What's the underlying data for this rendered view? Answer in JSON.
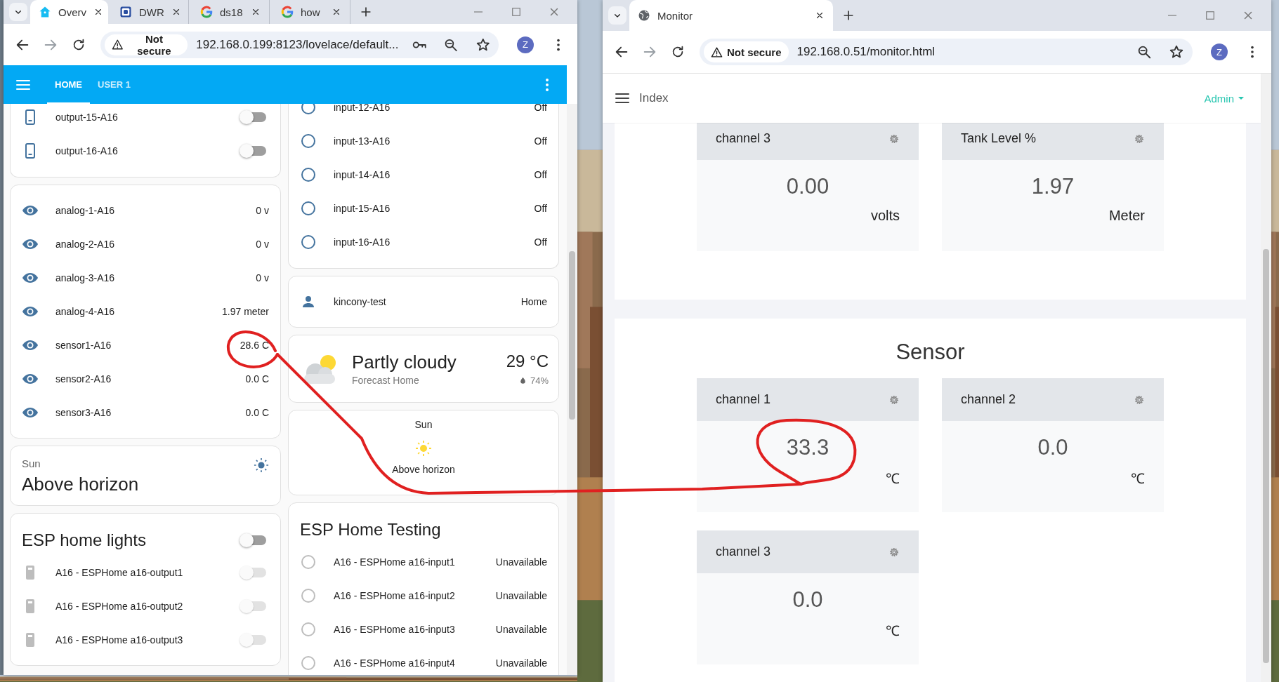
{
  "windows": [
    {
      "kind": "home-assistant",
      "tabs": [
        {
          "label": "Overv",
          "kind": "home",
          "selected": true
        },
        {
          "label": "DWR",
          "kind": "doc",
          "selected": false
        },
        {
          "label": "ds18",
          "kind": "search",
          "selected": false
        },
        {
          "label": "how",
          "kind": "search",
          "selected": false
        }
      ],
      "address": {
        "security": "Not secure",
        "url": "192.168.0.199:8123/lovelace/default...",
        "saved_password": true
      },
      "can_go_forward": false,
      "profile": "Z",
      "app_bar": {
        "views": [
          {
            "label": "HOME",
            "selected": true
          },
          {
            "label": "USER 1",
            "selected": false
          }
        ]
      },
      "columns": [
        [
          {
            "kind": "entities",
            "cut": true,
            "rows": [
              {
                "kind": "switch",
                "name": "output-15-A16",
                "on": false,
                "disabled": false
              },
              {
                "kind": "switch",
                "name": "output-16-A16",
                "on": false,
                "disabled": false
              }
            ]
          },
          {
            "kind": "entities",
            "cut": false,
            "rows": [
              {
                "kind": "sensor",
                "name": "analog-1-A16",
                "value": "0 v"
              },
              {
                "kind": "sensor",
                "name": "analog-2-A16",
                "value": "0 v"
              },
              {
                "kind": "sensor",
                "name": "analog-3-A16",
                "value": "0 v"
              },
              {
                "kind": "sensor",
                "name": "analog-4-A16",
                "value": "1.97 meter"
              },
              {
                "kind": "sensor",
                "name": "sensor1-A16",
                "value": "28.6 C"
              },
              {
                "kind": "sensor",
                "name": "sensor2-A16",
                "value": "0.0 C"
              },
              {
                "kind": "sensor",
                "name": "sensor3-A16",
                "value": "0.0 C"
              }
            ]
          },
          {
            "kind": "sun-state",
            "label": "Sun",
            "state": "Above horizon"
          },
          {
            "kind": "entities",
            "cut": false,
            "title": "ESP home lights",
            "header_toggle": {
              "on": false
            },
            "rows": [
              {
                "kind": "switch",
                "name": "A16 - ESPHome a16-output1",
                "on": false,
                "disabled": true
              },
              {
                "kind": "switch",
                "name": "A16 - ESPHome a16-output2",
                "on": false,
                "disabled": true
              },
              {
                "kind": "switch",
                "name": "A16 - ESPHome a16-output3",
                "on": false,
                "disabled": true
              }
            ]
          }
        ],
        [
          {
            "kind": "entities",
            "cut": true,
            "rows": [
              {
                "kind": "binary",
                "name": "input-12-A16",
                "value": "Off",
                "disabled": false
              },
              {
                "kind": "binary",
                "name": "input-13-A16",
                "value": "Off",
                "disabled": false
              },
              {
                "kind": "binary",
                "name": "input-14-A16",
                "value": "Off",
                "disabled": false
              },
              {
                "kind": "binary",
                "name": "input-15-A16",
                "value": "Off",
                "disabled": false
              },
              {
                "kind": "binary",
                "name": "input-16-A16",
                "value": "Off",
                "disabled": false
              }
            ]
          },
          {
            "kind": "entities",
            "cut": false,
            "rows": [
              {
                "kind": "person",
                "name": "kincony-test",
                "value": "Home"
              }
            ]
          },
          {
            "kind": "weather",
            "condition": "Partly cloudy",
            "source": "Forecast Home",
            "temperature": "29 °C",
            "humidity": "74%"
          },
          {
            "kind": "sun-glance",
            "label": "Sun",
            "state": "Above horizon"
          },
          {
            "kind": "entities",
            "cut": false,
            "title": "ESP Home Testing",
            "rows": [
              {
                "kind": "binary",
                "name": "A16 - ESPHome a16-input1",
                "value": "Unavailable",
                "disabled": true
              },
              {
                "kind": "binary",
                "name": "A16 - ESPHome a16-input2",
                "value": "Unavailable",
                "disabled": true
              },
              {
                "kind": "binary",
                "name": "A16 - ESPHome a16-input3",
                "value": "Unavailable",
                "disabled": true
              },
              {
                "kind": "binary",
                "name": "A16 - ESPHome a16-input4",
                "value": "Unavailable",
                "disabled": true
              }
            ]
          }
        ]
      ]
    },
    {
      "kind": "monitor",
      "tabs": [
        {
          "label": "Monitor",
          "kind": "globe",
          "selected": true
        }
      ],
      "address": {
        "security": "Not secure",
        "url": "192.168.0.51/monitor.html",
        "saved_password": false
      },
      "can_go_forward": false,
      "profile": "Z",
      "navbar": {
        "title": "Index",
        "user": "Admin"
      },
      "panels": [
        {
          "cut": true,
          "cards": [
            {
              "name": "channel 3",
              "value": "0.00",
              "unit": "volts"
            },
            {
              "name": "Tank Level %",
              "value": "1.97",
              "unit": "Meter"
            }
          ]
        },
        {
          "cut": false,
          "title": "Sensor",
          "cards": [
            {
              "name": "channel 1",
              "value": "33.3",
              "unit": "℃"
            },
            {
              "name": "channel 2",
              "value": "0.0",
              "unit": "℃"
            },
            {
              "name": "channel 3",
              "value": "0.0",
              "unit": "℃"
            }
          ]
        }
      ]
    }
  ]
}
